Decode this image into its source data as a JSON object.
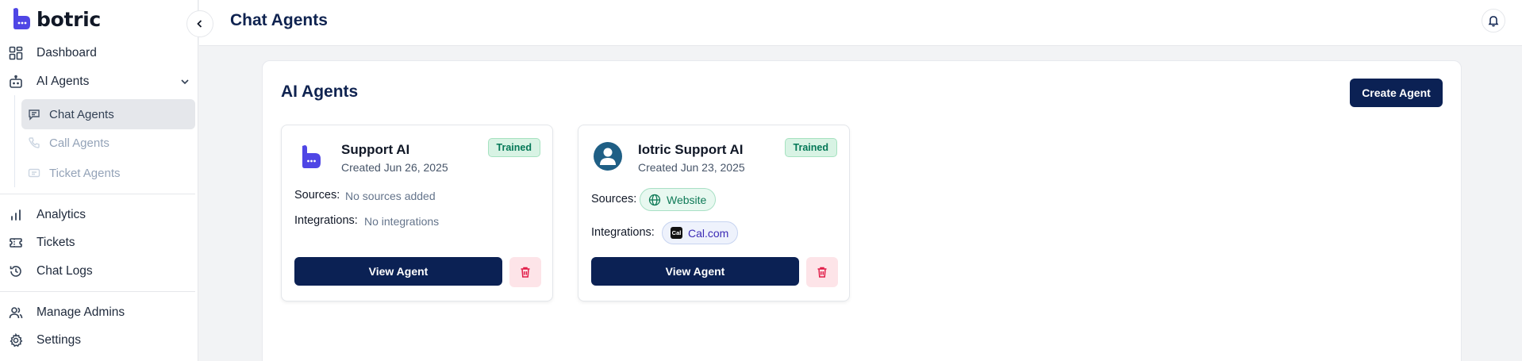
{
  "sidebar": {
    "brand": "botric",
    "nav": [
      {
        "label": "Dashboard",
        "icon": "dashboard-icon"
      },
      {
        "label": "AI Agents",
        "icon": "bot-icon",
        "expanded": true
      }
    ],
    "sub_items": [
      {
        "label": "Chat Agents",
        "icon": "chat-icon",
        "active": true
      },
      {
        "label": "Call Agents",
        "icon": "phone-icon",
        "active": false
      },
      {
        "label": "Ticket Agents",
        "icon": "ticket-icon",
        "active": false
      }
    ],
    "nav2": [
      {
        "label": "Analytics",
        "icon": "bar-chart-icon"
      },
      {
        "label": "Tickets",
        "icon": "ticket-icon"
      },
      {
        "label": "Chat Logs",
        "icon": "history-icon"
      }
    ],
    "nav3": [
      {
        "label": "Manage Admins",
        "icon": "users-icon"
      },
      {
        "label": "Settings",
        "icon": "gear-icon"
      }
    ]
  },
  "header": {
    "title": "Chat Agents"
  },
  "main": {
    "title": "AI Agents",
    "create_label": "Create Agent",
    "agents": [
      {
        "name": "Support AI",
        "created": "Created Jun 26, 2025",
        "status": "Trained",
        "sources_label": "Sources:",
        "sources_value": "No sources added",
        "integrations_label": "Integrations:",
        "integrations_value": "No integrations",
        "view_label": "View Agent"
      },
      {
        "name": "Iotric Support AI",
        "created": "Created Jun 23, 2025",
        "status": "Trained",
        "sources_label": "Sources:",
        "source_chip": "Website",
        "integrations_label": "Integrations:",
        "integration_chip": "Cal.com",
        "integration_chip_icon_text": "Cal",
        "view_label": "View Agent"
      }
    ]
  },
  "colors": {
    "brand": "#4f46e5",
    "primary_button": "#0b2154",
    "trained_badge": "#d8f3e4",
    "delete_bg": "#fde4e8",
    "delete_icon": "#e11d48"
  }
}
